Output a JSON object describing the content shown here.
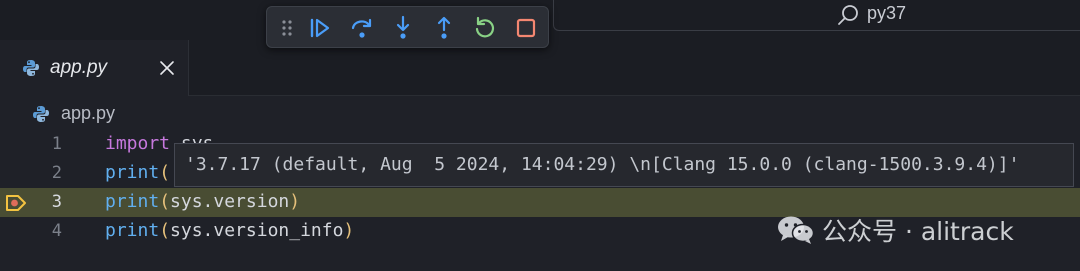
{
  "command_center": {
    "label": "py37",
    "icon": "search-icon"
  },
  "debug_toolbar": {
    "buttons": [
      {
        "name": "continue",
        "icon": "continue-icon",
        "color": "#4a9df8"
      },
      {
        "name": "step-over",
        "icon": "step-over-icon",
        "color": "#4a9df8"
      },
      {
        "name": "step-into",
        "icon": "step-into-icon",
        "color": "#4a9df8"
      },
      {
        "name": "step-out",
        "icon": "step-out-icon",
        "color": "#4a9df8"
      },
      {
        "name": "restart",
        "icon": "restart-icon",
        "color": "#89d185"
      },
      {
        "name": "stop",
        "icon": "stop-icon",
        "color": "#f48771"
      }
    ]
  },
  "tab": {
    "label": "app.py",
    "close_icon": "close-icon",
    "icon": "python-icon"
  },
  "breadcrumb": {
    "label": "app.py",
    "icon": "python-icon"
  },
  "editor": {
    "current_line": 3,
    "lines": [
      {
        "num": "1",
        "parts": [
          {
            "t": "import",
            "c": "kw-import"
          },
          {
            "t": " sys",
            "c": ""
          }
        ]
      },
      {
        "num": "2",
        "parts": [
          {
            "t": "print",
            "c": "kw-fn"
          },
          {
            "t": "(",
            "c": "paren"
          }
        ]
      },
      {
        "num": "3",
        "parts": [
          {
            "t": "print",
            "c": "kw-fn"
          },
          {
            "t": "(",
            "c": "paren"
          },
          {
            "t": "sys.version",
            "c": ""
          },
          {
            "t": ")",
            "c": "paren"
          }
        ]
      },
      {
        "num": "4",
        "parts": [
          {
            "t": "print",
            "c": "kw-fn"
          },
          {
            "t": "(",
            "c": "paren"
          },
          {
            "t": "sys.version_info",
            "c": ""
          },
          {
            "t": ")",
            "c": "paren"
          }
        ]
      }
    ]
  },
  "hover": {
    "text": "'3.7.17 (default, Aug  5 2024, 14:04:29) \\n[Clang 15.0.0 (clang-1500.3.9.4)]'"
  },
  "watermark": {
    "text": "公众号 · alitrack",
    "icon": "wechat-icon"
  },
  "colors": {
    "current_line_bg": "#494d33",
    "breakpoint": "#f3c341",
    "keyword_import": "#c678dd",
    "function": "#61afef",
    "paren": "#e5c07b"
  }
}
